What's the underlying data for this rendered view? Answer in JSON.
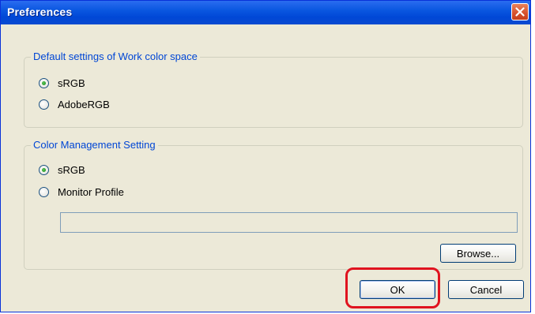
{
  "window": {
    "title": "Preferences"
  },
  "work_color_space": {
    "legend": "Default settings of Work color space",
    "options": [
      {
        "label": "sRGB",
        "selected": true
      },
      {
        "label": "AdobeRGB",
        "selected": false
      }
    ]
  },
  "color_management": {
    "legend": "Color Management Setting",
    "options": [
      {
        "label": "sRGB",
        "selected": true
      },
      {
        "label": "Monitor Profile",
        "selected": false
      }
    ],
    "profile_path_value": "",
    "browse_label": "Browse..."
  },
  "footer": {
    "ok_label": "OK",
    "cancel_label": "Cancel"
  },
  "annotation": {
    "highlight_color": "#e0131f",
    "highlight_target": "OK"
  }
}
